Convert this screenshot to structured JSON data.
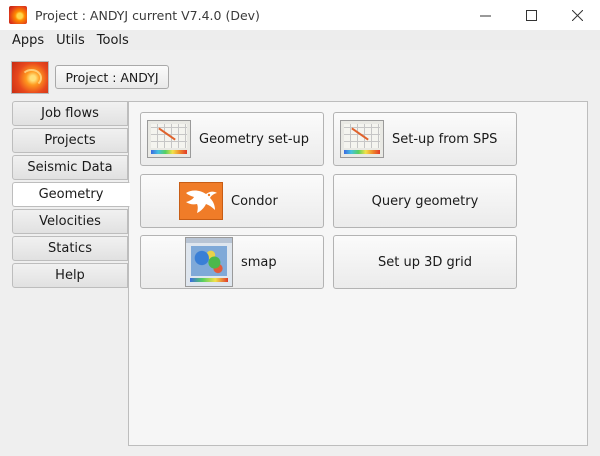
{
  "window": {
    "title": "Project : ANDYJ current V7.4.0 (Dev)",
    "app_icon": "app-logo-icon"
  },
  "menu": {
    "items": [
      {
        "label": "Apps"
      },
      {
        "label": "Utils"
      },
      {
        "label": "Tools"
      }
    ]
  },
  "project": {
    "button_label": "Project : ANDYJ"
  },
  "tabs": [
    {
      "label": "Job flows",
      "active": false
    },
    {
      "label": "Projects",
      "active": false
    },
    {
      "label": "Seismic Data",
      "active": false
    },
    {
      "label": "Geometry",
      "active": true
    },
    {
      "label": "Velocities",
      "active": false
    },
    {
      "label": "Statics",
      "active": false
    },
    {
      "label": "Help",
      "active": false
    }
  ],
  "tools": [
    {
      "label": "Geometry set-up",
      "icon": "geometry-plot-icon"
    },
    {
      "label": "Set-up from SPS",
      "icon": "geometry-plot-icon"
    },
    {
      "label": "Condor",
      "icon": "condor-icon"
    },
    {
      "label": "Query geometry",
      "icon": ""
    },
    {
      "label": "smap",
      "icon": "map-thumbnail-icon"
    },
    {
      "label": "Set up 3D grid",
      "icon": ""
    }
  ],
  "colors": {
    "condor_orange": "#f07c28",
    "window_bg": "#efefef",
    "panel_bg": "#f6f6f6"
  }
}
